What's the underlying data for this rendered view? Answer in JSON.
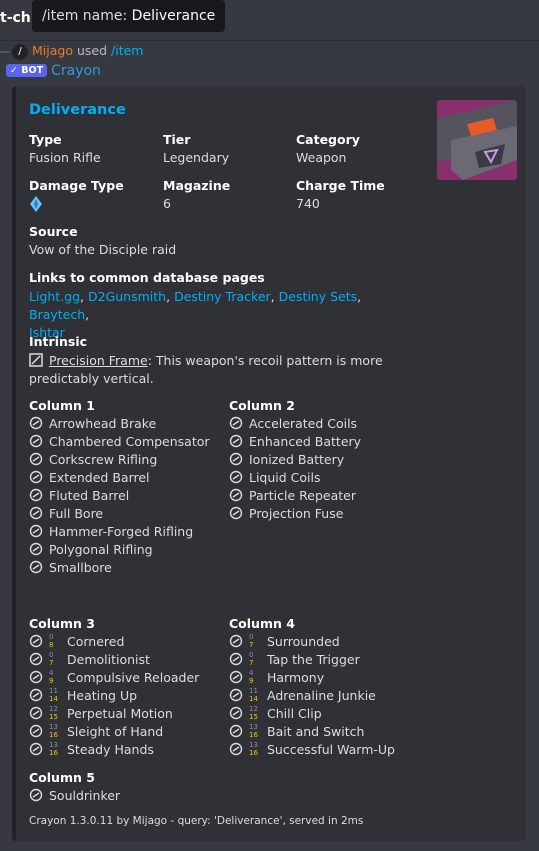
{
  "channel": {
    "name": "t-ch"
  },
  "tooltip": {
    "label": "/item name:",
    "value": "Deliverance"
  },
  "reply": {
    "avatar": "/",
    "user": "Mijago",
    "verb": "used",
    "command": "/item"
  },
  "bot": {
    "badge": "✓ BOT",
    "name": "Crayon"
  },
  "embed": {
    "title": "Deliverance",
    "fields": {
      "type": {
        "name": "Type",
        "value": "Fusion Rifle"
      },
      "tier": {
        "name": "Tier",
        "value": "Legendary"
      },
      "category": {
        "name": "Category",
        "value": "Weapon"
      },
      "damage_type": {
        "name": "Damage Type",
        "icon": "arc-damage-icon"
      },
      "magazine": {
        "name": "Magazine",
        "value": "6"
      },
      "charge_time": {
        "name": "Charge Time",
        "value": "740"
      },
      "source": {
        "name": "Source",
        "value": "Vow of the Disciple raid"
      }
    },
    "links": {
      "name": "Links to common database pages",
      "items": [
        "Light.gg",
        "D2Gunsmith",
        "Destiny Tracker",
        "Destiny Sets",
        "Braytech",
        "Ishtar"
      ],
      "sep": ", "
    },
    "intrinsic": {
      "name": "Intrinsic",
      "perk": "Precision Frame",
      "desc_a": ": This weapon's recoil pattern is more",
      "desc_b": "predictably vertical."
    },
    "column1": {
      "name": "Column 1",
      "perks": [
        "Arrowhead Brake",
        "Chambered Compensator",
        "Corkscrew Rifling",
        "Extended Barrel",
        "Fluted Barrel",
        "Full Bore",
        "Hammer-Forged Rifling",
        "Polygonal Rifling",
        "Smallbore"
      ]
    },
    "column2": {
      "name": "Column 2",
      "perks": [
        "Accelerated Coils",
        "Enhanced Battery",
        "Ionized Battery",
        "Liquid Coils",
        "Particle Repeater",
        "Projection Fuse"
      ]
    },
    "column3": {
      "name": "Column 3",
      "perks": [
        {
          "name": "Cornered",
          "lv": "0",
          "ench": "8"
        },
        {
          "name": "Demolitionist",
          "lv": "0",
          "ench": "7"
        },
        {
          "name": "Compulsive Reloader",
          "lv": "4",
          "ench": "9"
        },
        {
          "name": "Heating Up",
          "lv": "11",
          "ench": "14"
        },
        {
          "name": "Perpetual Motion",
          "lv": "12",
          "ench": "15"
        },
        {
          "name": "Sleight of Hand",
          "lv": "13",
          "ench": "16"
        },
        {
          "name": "Steady Hands",
          "lv": "13",
          "ench": "16"
        }
      ]
    },
    "column4": {
      "name": "Column 4",
      "perks": [
        {
          "name": "Surrounded",
          "lv": "0",
          "ench": "7"
        },
        {
          "name": "Tap the Trigger",
          "lv": "0",
          "ench": "7"
        },
        {
          "name": "Harmony",
          "lv": "4",
          "ench": "9"
        },
        {
          "name": "Adrenaline Junkie",
          "lv": "11",
          "ench": "14"
        },
        {
          "name": "Chill Clip",
          "lv": "12",
          "ench": "15"
        },
        {
          "name": "Bait and Switch",
          "lv": "13",
          "ench": "16"
        },
        {
          "name": "Successful Warm-Up",
          "lv": "13",
          "ench": "16"
        }
      ]
    },
    "column5": {
      "name": "Column 5",
      "perks": [
        "Souldrinker"
      ]
    },
    "footer": "Crayon 1.3.0.11 by Mijago - query: 'Deliverance', served in 2ms"
  },
  "colors": {
    "link": "#00aff4",
    "bot": "#5865f2",
    "user": "#e67e22",
    "level": "#f1c40f"
  }
}
